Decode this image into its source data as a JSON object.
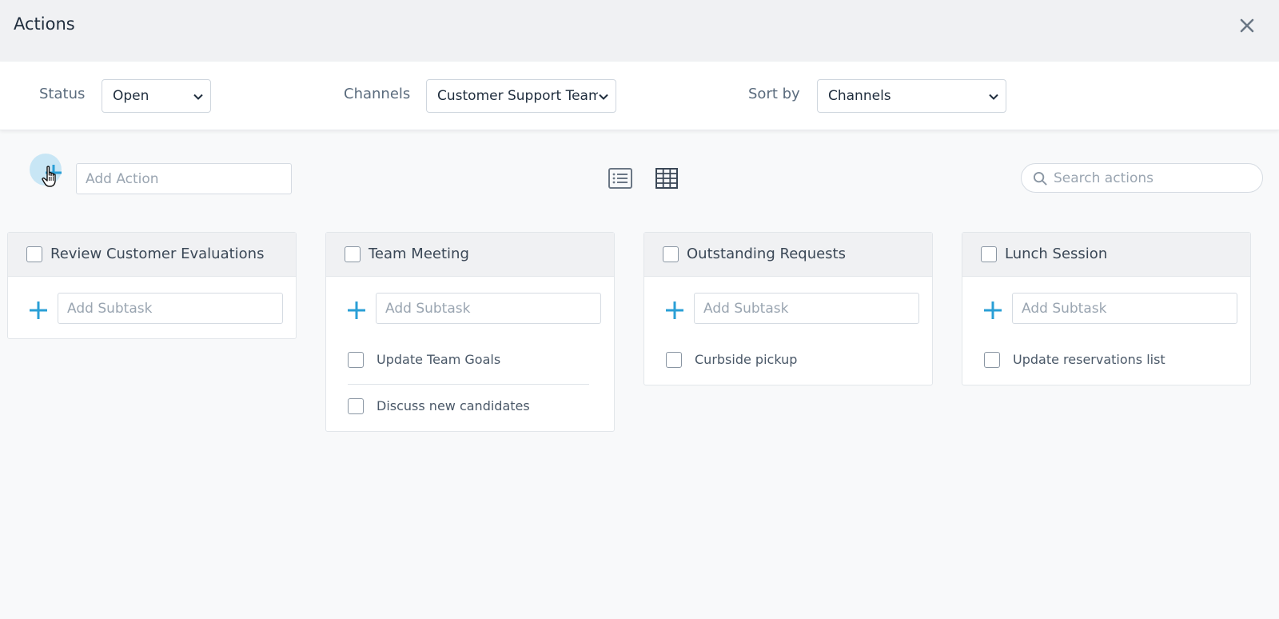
{
  "header": {
    "title": "Actions",
    "close_icon": "close-icon"
  },
  "filters": {
    "status": {
      "label": "Status",
      "value": "Open"
    },
    "channels": {
      "label": "Channels",
      "value": "Customer Support Team"
    },
    "sort": {
      "label": "Sort by",
      "value": "Channels"
    }
  },
  "toolbar": {
    "add_action_placeholder": "Add Action",
    "search_placeholder": "Search actions",
    "views": [
      "list-view-icon",
      "grid-view-icon"
    ]
  },
  "colors": {
    "accent": "#2a9fd6",
    "header_bg": "#f0f1f3",
    "add_circle_bg": "#c8e6f5"
  },
  "cards": [
    {
      "title": "Review Customer Evaluations",
      "subtask_placeholder": "Add Subtask",
      "subtasks": []
    },
    {
      "title": "Team Meeting",
      "subtask_placeholder": "Add Subtask",
      "subtasks": [
        "Update Team Goals",
        "Discuss new candidates"
      ]
    },
    {
      "title": "Outstanding Requests",
      "subtask_placeholder": "Add Subtask",
      "subtasks": [
        "Curbside pickup"
      ]
    },
    {
      "title": "Lunch Session",
      "subtask_placeholder": "Add Subtask",
      "subtasks": [
        "Update reservations list"
      ]
    }
  ]
}
